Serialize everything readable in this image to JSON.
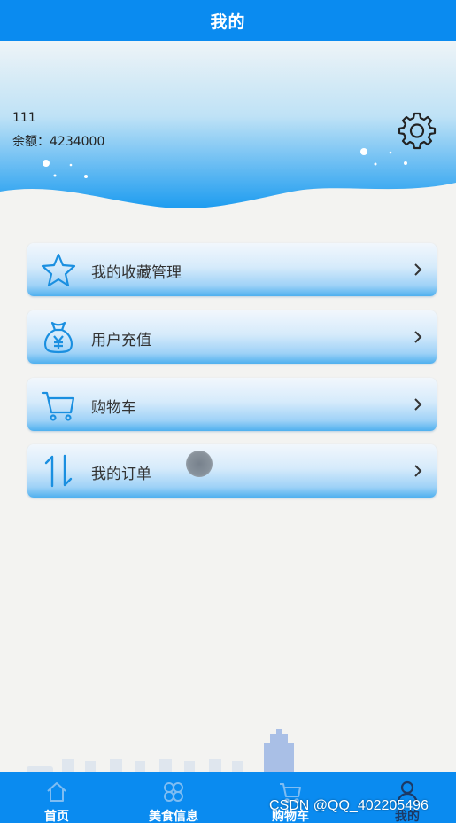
{
  "header": {
    "title": "我的"
  },
  "profile": {
    "username": "111",
    "balance": "余额：4234000"
  },
  "menu": [
    {
      "label": "我的收藏管理",
      "icon": "star-icon"
    },
    {
      "label": "用户充值",
      "icon": "money-bag-icon"
    },
    {
      "label": "购物车",
      "icon": "cart-icon"
    },
    {
      "label": "我的订单",
      "icon": "sort-arrows-icon"
    }
  ],
  "tabbar": {
    "items": [
      {
        "label": "首页",
        "icon": "home-icon"
      },
      {
        "label": "美食信息",
        "icon": "grid-icon"
      },
      {
        "label": "购物车",
        "icon": "cart-icon"
      },
      {
        "label": "我的",
        "icon": "user-icon"
      }
    ]
  },
  "watermark": "CSDN @QQ_402205496",
  "colors": {
    "primary": "#0a8bf0",
    "background": "#f3f3f1",
    "icon_blue": "#1a8fe0"
  }
}
